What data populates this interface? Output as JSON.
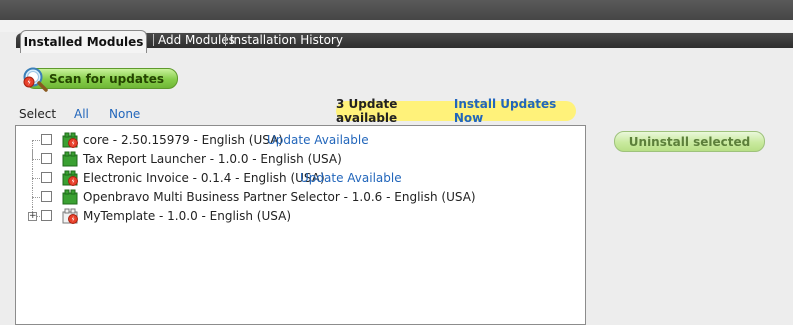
{
  "tabs": {
    "installed_modules": "Installed Modules",
    "add_modules": "Add Modules",
    "installation_history": "Installation History"
  },
  "actions": {
    "scan_for_updates": "Scan for updates",
    "uninstall_selected": "Uninstall selected"
  },
  "select": {
    "label": "Select",
    "all": "All",
    "none": "None"
  },
  "updates_banner": {
    "count_text": "3 Update available",
    "install_link": "Install Updates Now"
  },
  "modules": [
    {
      "label": "core - 2.50.15979 - English (USA)",
      "update": "Update Available",
      "icon": "module-update-icon",
      "checked": false
    },
    {
      "label": "Tax Report Launcher - 1.0.0 - English (USA)",
      "update": "",
      "icon": "module-icon",
      "checked": false
    },
    {
      "label": "Electronic Invoice - 0.1.4 - English (USA)",
      "update": "Update Available",
      "icon": "module-update-icon",
      "checked": false
    },
    {
      "label": "Openbravo Multi Business Partner Selector - 1.0.6 - English (USA)",
      "update": "",
      "icon": "module-icon",
      "checked": false
    },
    {
      "label": "MyTemplate - 1.0.0 - English (USA)",
      "update": "",
      "icon": "template-icon",
      "expandable": true,
      "checked": false
    }
  ],
  "colors": {
    "topbar": "#464646",
    "tabbar": "#2e2e2e",
    "button_green": "#86cd4a",
    "banner": "#fff27a",
    "link": "#2266bb"
  }
}
